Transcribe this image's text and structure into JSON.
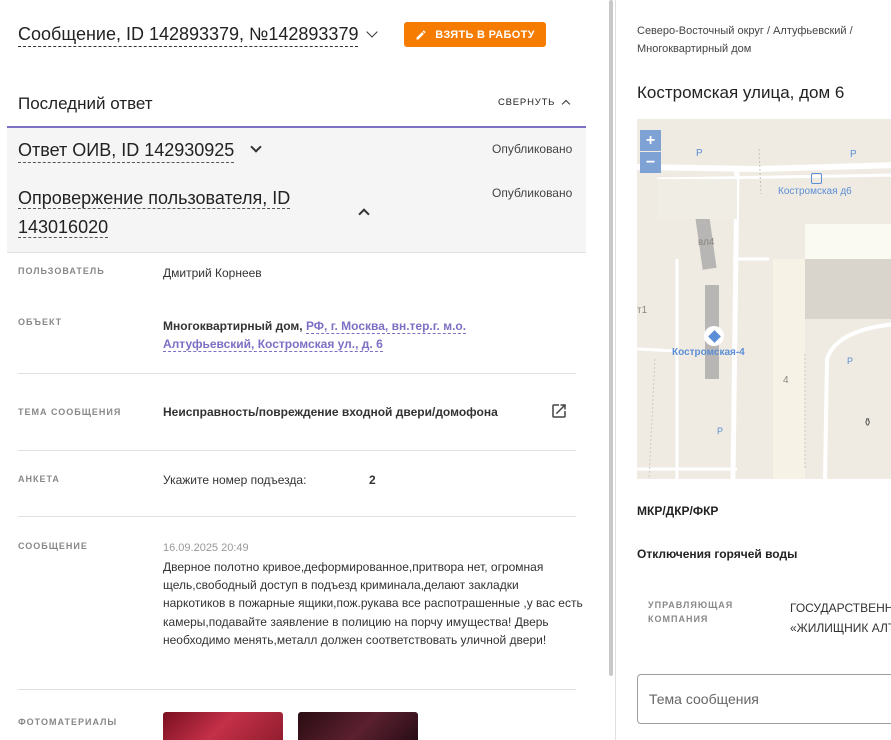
{
  "message": {
    "title": "Сообщение, ID 142893379, №142893379",
    "take_button": "ВЗЯТЬ В РАБОТУ"
  },
  "last_answer": {
    "heading": "Последний ответ",
    "collapse_label": "СВЕРНУТЬ",
    "answers": [
      {
        "title": "Ответ ОИВ, ID 142930925",
        "status": "Опубликовано"
      },
      {
        "title": "Опровержение пользователя, ID 143016020",
        "status": "Опубликовано"
      }
    ]
  },
  "details": {
    "user_label": "ПОЛЬЗОВАТЕЛЬ",
    "user_value": "Дмитрий Корнеев",
    "object_label": "ОБЪЕКТ",
    "object_type": "Многоквартирный дом,",
    "object_link_line1": "РФ, г. Москва, вн.тер.г. м.о.",
    "object_link_line2": "Алтуфьевский, Костромская ул., д. 6",
    "topic_label": "ТЕМА СООБЩЕНИЯ",
    "topic_value": "Неисправность/повреждение входной двери/домофона",
    "form_label": "АНКЕТА",
    "form_question": "Укажите номер подъезда:",
    "form_answer": "2",
    "message_label": "СООБЩЕНИЕ",
    "message_date": "16.09.2025 20:49",
    "message_text": "Дверное полотно кривое,деформированное,притвора нет, огромная щель,свободный доступ в подъезд криминала,делают закладки наркотиков в пожарные ящики,пож.рукава все распотрашенные ,у вас есть камеры,подавайте заявление в полицию на порчу имущества! Дверь необходимо менять,металл должен соответствовать уличной двери!",
    "photos_label": "ФОТОМАТЕРИАЛЫ"
  },
  "right_panel": {
    "breadcrumb": "Северо-Восточный округ / Алтуфьевский / Многоквартирный дом",
    "address_title": "Костромская улица, дом 6",
    "map": {
      "zoom_in": "+",
      "zoom_out": "−",
      "labels": {
        "bus_stop": "Костромская д6",
        "building_label": "Костромская-4",
        "bld_vl4": "вл4",
        "bld_t1": "т1",
        "bld_4": "4",
        "parking": "P"
      }
    },
    "mkr_label": "МКР/ДКР/ФКР",
    "hot_water_label": "Отключения горячей воды",
    "mc_label": "УПРАВЛЯЮЩАЯ КОМПАНИЯ",
    "mc_value_line1": "ГОСУДАРСТВЕННОЕ",
    "mc_value_line2": "«ЖИЛИЩНИК АЛТУФЬЕВСКИЙ»",
    "subject_placeholder": "Тема сообщения"
  },
  "colors": {
    "accent_orange": "#f57c00",
    "accent_purple": "#7e6fc4",
    "map_zoom": "#7ea2d4"
  }
}
